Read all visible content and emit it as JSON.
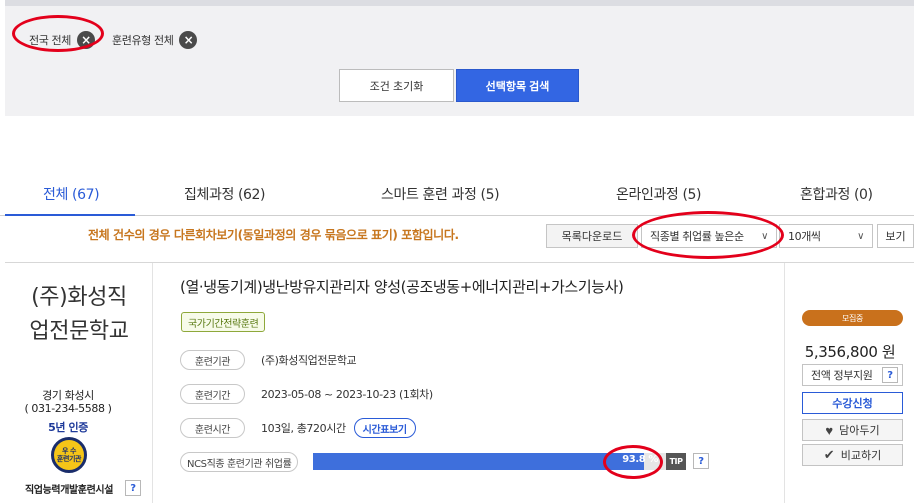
{
  "filters": {
    "chips": [
      {
        "label": "전국 전체"
      },
      {
        "label": "훈련유형 전체"
      }
    ],
    "reset_label": "조건 초기화",
    "search_label": "선택항목 검색"
  },
  "tabs": [
    {
      "label": "전체 (67)"
    },
    {
      "label": "집체과정 (62)"
    },
    {
      "label": "스마트 훈련 과정 (5)"
    },
    {
      "label": "온라인과정 (5)"
    },
    {
      "label": "혼합과정 (0)"
    }
  ],
  "toolbar": {
    "notice": "전체 건수의 경우 다른회차보기(동일과정의 경우 묶음으로 표기) 포함입니다.",
    "download_label": "목록다운로드",
    "sort_selected": "직종별 취업률 높은순",
    "count_selected": "10개씩",
    "view_label": "보기"
  },
  "course": {
    "institution_name": "(주)화성직업전문학교",
    "region": "경기 화성시",
    "phone": "( 031-234-5588 )",
    "certification": "5년 인증",
    "badge_line1": "우 수",
    "badge_line2": "훈련기관",
    "institution_type": "직업능력개발훈련시설",
    "title": "(열·냉동기계)냉난방유지관리자 양성(공조냉동+에너지관리+가스기능사)",
    "tag": "국가기간전략훈련",
    "info": {
      "org_label": "훈련기관",
      "org_value": "(주)화성직업전문학교",
      "period_label": "훈련기간",
      "period_value": "2023-05-08 ~ 2023-10-23 (1회차)",
      "hours_label": "훈련시간",
      "hours_value": "103일, 총720시간",
      "timetable_label": "시간표보기",
      "employment_label": "NCS직종 훈련기관 취업률",
      "employment_value": "93.8 %",
      "employment_rate": 93.8,
      "tip_label": "TIP"
    },
    "status": "모집중",
    "price": "5,356,800 원",
    "support": "전액 정부지원",
    "apply_label": "수강신청",
    "wishlist_label": "담아두기",
    "compare_label": "비교하기"
  },
  "colors": {
    "accent": "#3366e3",
    "highlight_ring": "#e3001b",
    "status": "#c9711c"
  },
  "icons": {
    "remove": "close-circle-icon",
    "dropdown": "chevron-down-icon",
    "help": "question-icon",
    "wishlist": "heart-icon",
    "compare": "check-icon"
  }
}
